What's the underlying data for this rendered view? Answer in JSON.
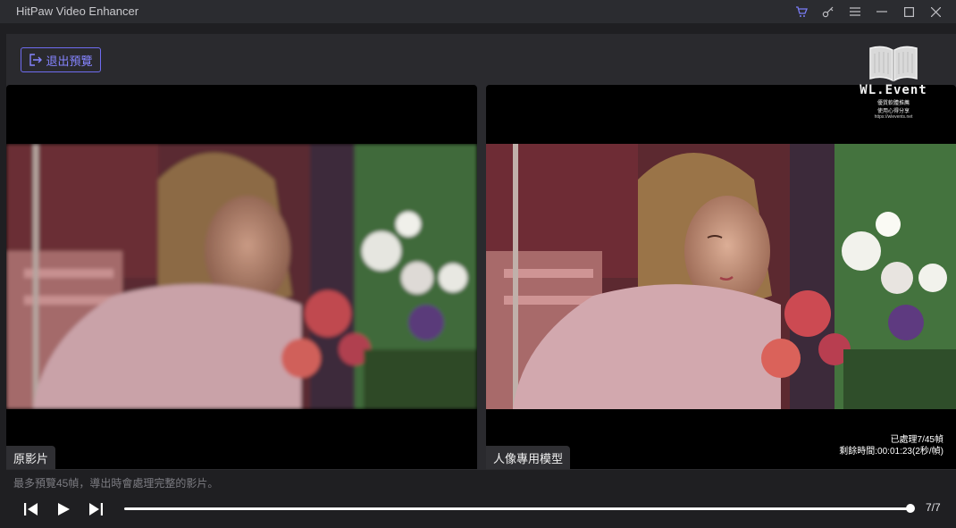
{
  "window": {
    "title": "HitPaw Video Enhancer",
    "controls": [
      "cart-icon",
      "key-icon",
      "menu-icon",
      "minimize-icon",
      "maximize-icon",
      "close-icon"
    ]
  },
  "toolbar": {
    "exit_preview_label": "退出預覽"
  },
  "watermark": {
    "title": "WL.Event",
    "line1": "優質軟體推薦",
    "line2": "使用心得分享",
    "url": "https://wlevents.net"
  },
  "panes": {
    "left_label": "原影片",
    "right_label": "人像專用模型"
  },
  "processing": {
    "processed": "已處理7/45幀",
    "remaining": "剩餘時間:00:01:23(2秒/幀)"
  },
  "hint": "最多預覽45幀，導出時會處理完整的影片。",
  "playback": {
    "frame_counter": "7/7",
    "progress_fraction": 1.0
  },
  "colors": {
    "accent": "#7a7cf5",
    "background": "#1f1f22",
    "panel": "#2a2a2e"
  }
}
